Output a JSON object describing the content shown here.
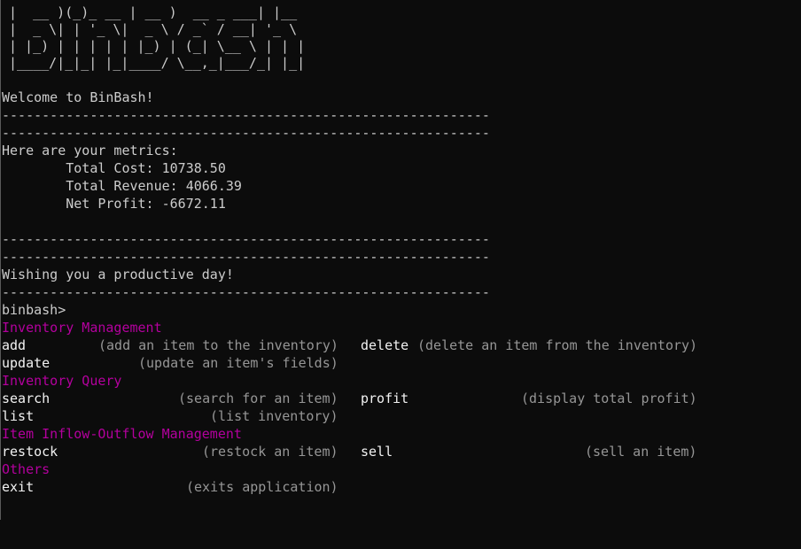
{
  "logo_lines": [
    "|  __ )(_)_ __ | __ )  __ _ ___| |__",
    "|  _ \\| | '_ \\|  _ \\ / _` / __| '_ \\",
    "| |_) | | | | | |_) | (_| \\__ \\ | | |",
    "|____/|_|_| |_|____/ \\__,_|___/_| |_|"
  ],
  "welcome": "Welcome to BinBash!",
  "divider": "-------------------------------------------------------------",
  "metrics": {
    "heading": "Here are your metrics:",
    "total_cost": "        Total Cost: 10738.50",
    "total_revenue": "        Total Revenue: 4066.39",
    "net_profit": "        Net Profit: -6672.11"
  },
  "wish": "Wishing you a productive day!",
  "prompt": "binbash>",
  "help": {
    "inventory_management": {
      "title": "Inventory Management",
      "add": {
        "cmd": "add",
        "desc": "(add an item to the inventory)"
      },
      "delete": {
        "cmd": "delete",
        "desc": "(delete an item from the inventory)"
      },
      "update": {
        "cmd": "update",
        "desc": "(update an item's fields)"
      }
    },
    "inventory_query": {
      "title": "Inventory Query",
      "search": {
        "cmd": "search",
        "desc": "(search for an item)"
      },
      "profit": {
        "cmd": "profit",
        "desc": "(display total profit)"
      },
      "list": {
        "cmd": "list",
        "desc": "(list inventory)"
      }
    },
    "inflow_outflow": {
      "title": "Item Inflow-Outflow Management",
      "restock": {
        "cmd": "restock",
        "desc": "(restock an item)"
      },
      "sell": {
        "cmd": "sell",
        "desc": "(sell an item)"
      }
    },
    "others": {
      "title": "Others",
      "exit": {
        "cmd": "exit",
        "desc": "(exits application)"
      }
    }
  }
}
